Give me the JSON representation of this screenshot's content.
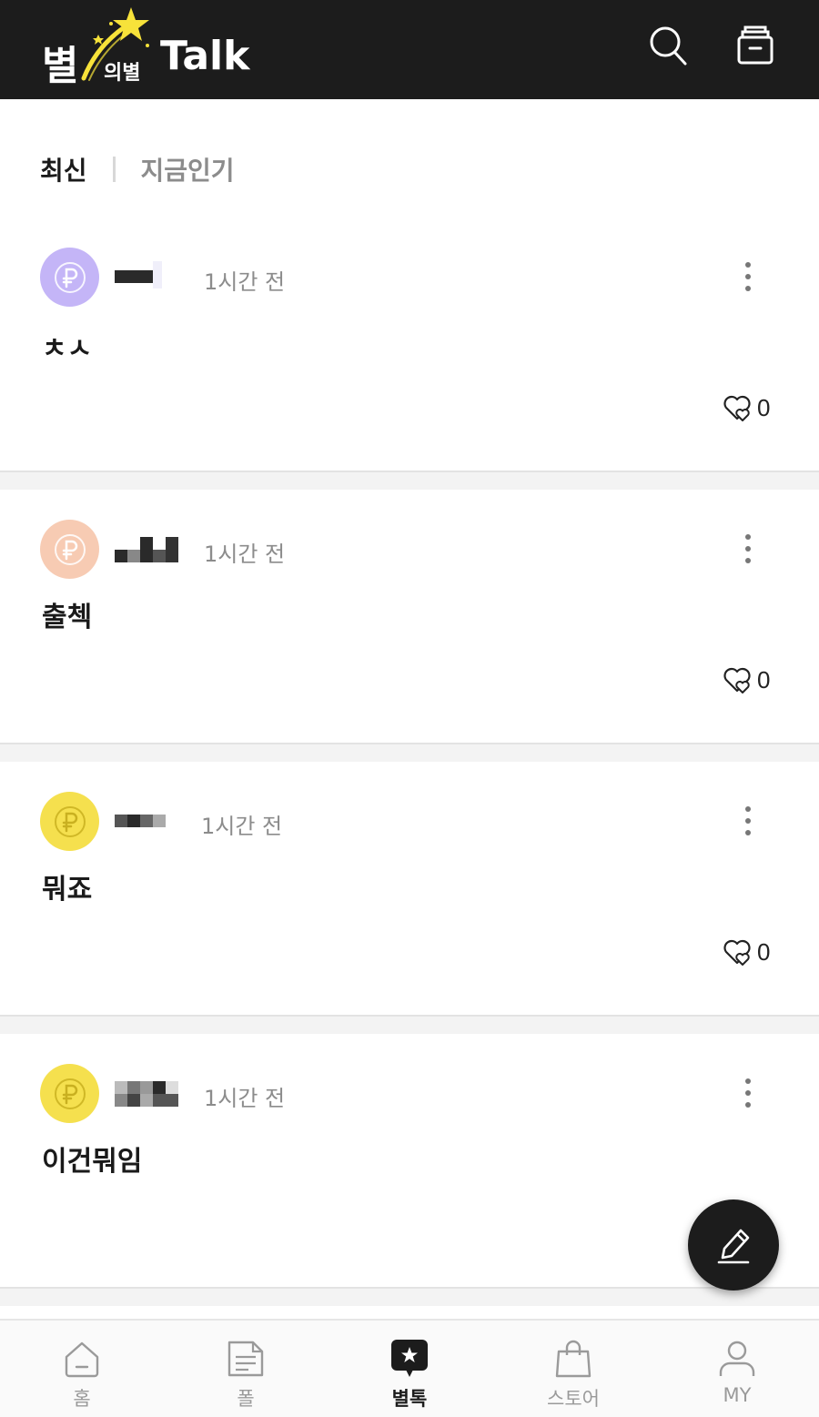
{
  "header": {
    "logo_main": "별",
    "logo_sub": "의별",
    "logo_talk": "Talk"
  },
  "tabs": [
    {
      "label": "최신",
      "active": true
    },
    {
      "label": "지금인기",
      "active": false
    }
  ],
  "posts": [
    {
      "time": "1시간 전",
      "content": "ㅊㅅ",
      "likes": "0",
      "avatar_color": "#c4b5f7"
    },
    {
      "time": "1시간 전",
      "content": "출첵",
      "likes": "0",
      "avatar_color": "#f7cbb3"
    },
    {
      "time": "1시간 전",
      "content": "뭐죠",
      "likes": "0",
      "avatar_color": "#f5e04e"
    },
    {
      "time": "1시간 전",
      "content": "이건뭐임",
      "likes": "0",
      "avatar_color": "#f5e04e"
    }
  ],
  "bottom_nav": [
    {
      "label": "홈",
      "icon": "home-icon",
      "active": false
    },
    {
      "label": "폴",
      "icon": "document-icon",
      "active": false
    },
    {
      "label": "별톡",
      "icon": "star-chat-icon",
      "active": true
    },
    {
      "label": "스토어",
      "icon": "shopping-bag-icon",
      "active": false
    },
    {
      "label": "MY",
      "icon": "user-icon",
      "active": false
    }
  ],
  "colors": {
    "header_bg": "#1c1c1c",
    "accent_star": "#f7e23a",
    "inactive_text": "#8c8c8c"
  }
}
